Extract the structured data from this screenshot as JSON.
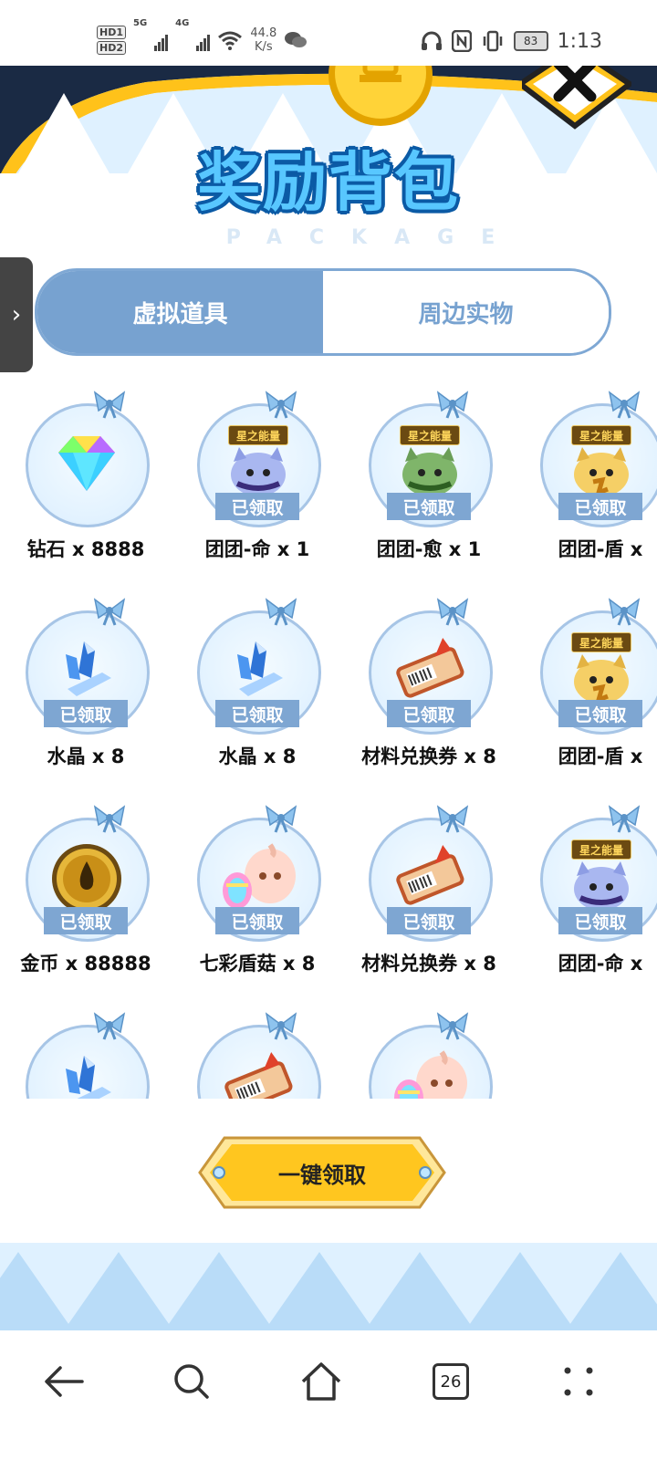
{
  "status_bar": {
    "hd1": "HD1",
    "hd2": "HD2",
    "net1": "5G",
    "net2": "4G",
    "speed_value": "44.8",
    "speed_unit": "K/s",
    "battery": "83",
    "time": "1:13"
  },
  "header": {
    "title": "奖励背包",
    "subtitle": "PACKAGE"
  },
  "side_handle": {
    "glyph": "›"
  },
  "tabs": [
    {
      "label": "虚拟道具",
      "active": true
    },
    {
      "label": "周边实物",
      "active": false
    }
  ],
  "items": [
    {
      "name": "钻石 x 8888",
      "icon": "diamond-icon",
      "claimed": false,
      "star_tag": false
    },
    {
      "name": "团团-命 x 1",
      "icon": "pet-blue-icon",
      "claimed": true,
      "star_tag": true
    },
    {
      "name": "团团-愈 x 1",
      "icon": "pet-green-icon",
      "claimed": true,
      "star_tag": true
    },
    {
      "name": "团团-盾 x",
      "icon": "pet-gold-icon",
      "claimed": true,
      "star_tag": true
    },
    {
      "name": "水晶 x 8",
      "icon": "crystal-icon",
      "claimed": true,
      "star_tag": false
    },
    {
      "name": "水晶 x 8",
      "icon": "crystal-icon",
      "claimed": true,
      "star_tag": false
    },
    {
      "name": "材料兑换券 x 8",
      "icon": "ticket-icon",
      "claimed": true,
      "star_tag": false
    },
    {
      "name": "团团-盾 x",
      "icon": "pet-gold-icon",
      "claimed": true,
      "star_tag": true
    },
    {
      "name": "金币 x 88888",
      "icon": "coin-icon",
      "claimed": true,
      "star_tag": false
    },
    {
      "name": "七彩盾菇 x 8",
      "icon": "mushroom-icon",
      "claimed": true,
      "star_tag": false
    },
    {
      "name": "材料兑换券 x 8",
      "icon": "ticket-icon",
      "claimed": true,
      "star_tag": false
    },
    {
      "name": "团团-命 x",
      "icon": "pet-blue-icon",
      "claimed": true,
      "star_tag": true
    },
    {
      "name": "",
      "icon": "crystal-icon",
      "claimed": false,
      "star_tag": false
    },
    {
      "name": "",
      "icon": "ticket-icon",
      "claimed": false,
      "star_tag": false
    },
    {
      "name": "",
      "icon": "mushroom-icon",
      "claimed": false,
      "star_tag": false
    }
  ],
  "claimed_label": "已领取",
  "star_tag_label": "星之能量",
  "claim_all_label": "一键领取",
  "nav": {
    "tab_count": "26"
  },
  "colors": {
    "accent_blue": "#77a2d0",
    "title_blue": "#58c7ff",
    "gold": "#ffc21a"
  }
}
